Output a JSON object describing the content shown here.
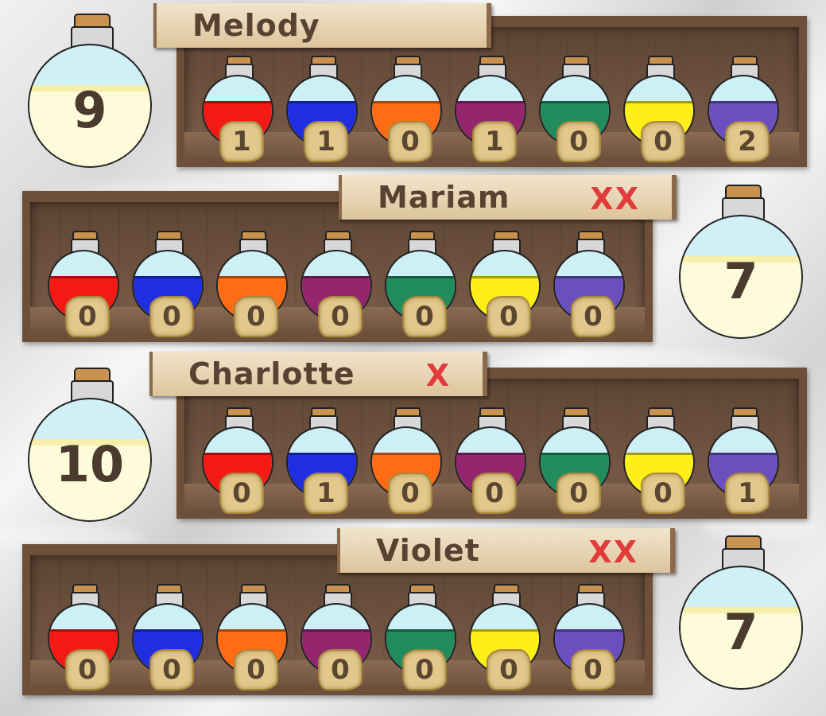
{
  "colors": {
    "red": "#f41a14",
    "blue": "#1f2ee0",
    "orange": "#ff6c14",
    "purple": "#94266e",
    "green": "#228c5c",
    "yellow": "#ffee18",
    "violet": "#6b4fbe",
    "strike": "#e23b3b"
  },
  "potion_order": [
    "red",
    "blue",
    "orange",
    "purple",
    "green",
    "yellow",
    "violet"
  ],
  "players": [
    {
      "name": "Melody",
      "strikes": "",
      "score": "9",
      "potions": [
        "1",
        "1",
        "0",
        "1",
        "0",
        "0",
        "2"
      ]
    },
    {
      "name": "Mariam",
      "strikes": "XX",
      "score": "7",
      "potions": [
        "0",
        "0",
        "0",
        "0",
        "0",
        "0",
        "0"
      ]
    },
    {
      "name": "Charlotte",
      "strikes": "X",
      "score": "10",
      "potions": [
        "0",
        "1",
        "0",
        "0",
        "0",
        "0",
        "1"
      ]
    },
    {
      "name": "Violet",
      "strikes": "XX",
      "score": "7",
      "potions": [
        "0",
        "0",
        "0",
        "0",
        "0",
        "0",
        "0"
      ]
    }
  ]
}
